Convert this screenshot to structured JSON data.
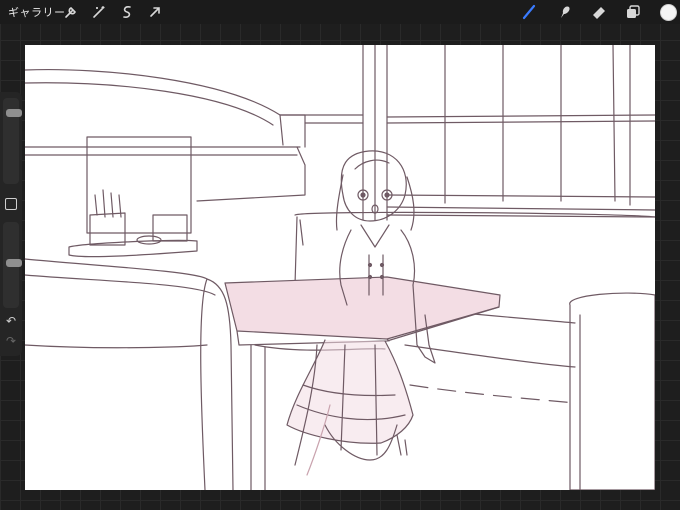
{
  "toolbar": {
    "gallery_label": "ギャラリー",
    "left_icons": [
      "wrench-icon",
      "magic-wand-icon",
      "selection-s-icon",
      "transform-arrow-icon"
    ],
    "right_icons": [
      "brush-icon",
      "smudge-icon",
      "eraser-icon",
      "layers-icon"
    ],
    "active_tool": "brush",
    "accent_color": "#3a7bff",
    "current_color": "#f5f5f5"
  },
  "sidebar": {
    "size_slider_level": 0.1,
    "opacity_slider_level": 0.45,
    "undo_glyph": "↶",
    "redo_glyph": "↷"
  },
  "canvas": {
    "background": "#ffffff",
    "line_color": "#6f5a64",
    "fill_color": "#f3dde4"
  }
}
